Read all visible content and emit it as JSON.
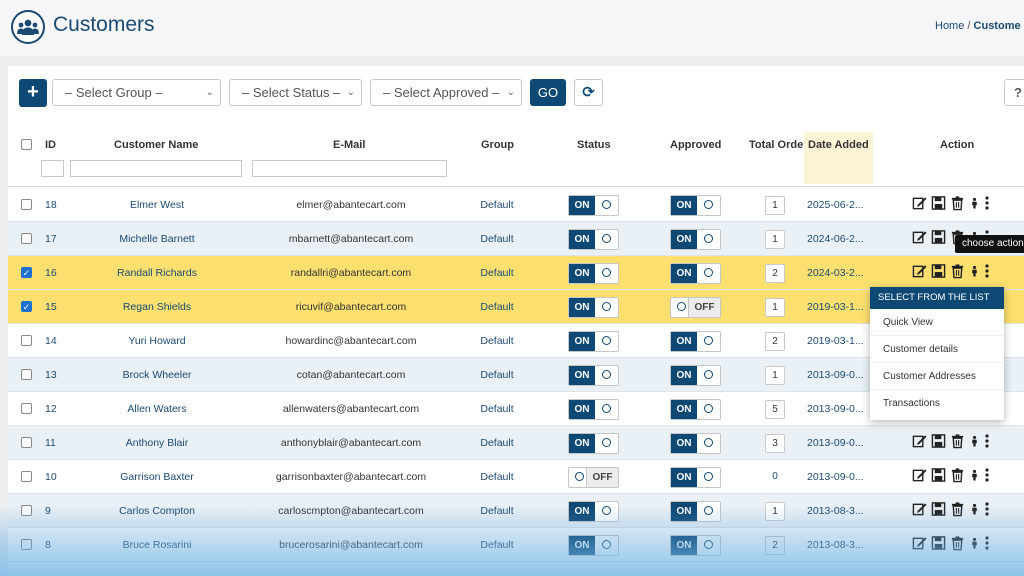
{
  "header": {
    "title": "Customers",
    "breadcrumb_home": "Home",
    "breadcrumb_sep": "/",
    "breadcrumb_current": "Custome"
  },
  "toolbar": {
    "add_label": "+",
    "group_select": "– Select Group –",
    "status_select": "– Select Status –",
    "approved_select": "– Select Approved –",
    "go_label": "GO",
    "refresh_icon": "refresh-icon",
    "help_label": "?"
  },
  "table": {
    "headers": {
      "id": "ID",
      "name": "Customer Name",
      "email": "E-Mail",
      "group": "Group",
      "status": "Status",
      "approved": "Approved",
      "total_orders": "Total Orde",
      "date_added": "Date Added",
      "action": "Action"
    },
    "on_label": "ON",
    "off_label": "OFF",
    "rows": [
      {
        "id": "18",
        "name": "Elmer West",
        "email": "elmer@abantecart.com",
        "group": "Default",
        "status": "ON",
        "approved": "ON",
        "orders": "1",
        "date": "2025-06-2...",
        "checked": false
      },
      {
        "id": "17",
        "name": "Michelle Barnett",
        "email": "mbarnett@abantecart.com",
        "group": "Default",
        "status": "ON",
        "approved": "ON",
        "orders": "1",
        "date": "2024-06-2...",
        "checked": false
      },
      {
        "id": "16",
        "name": "Randall Richards",
        "email": "randallri@abantecart.com",
        "group": "Default",
        "status": "ON",
        "approved": "ON",
        "orders": "2",
        "date": "2024-03-2...",
        "checked": true
      },
      {
        "id": "15",
        "name": "Regan Shields",
        "email": "ricuvif@abantecart.com",
        "group": "Default",
        "status": "ON",
        "approved": "OFF",
        "orders": "1",
        "date": "2019-03-1...",
        "checked": true
      },
      {
        "id": "14",
        "name": "Yuri Howard",
        "email": "howardinc@abantecart.com",
        "group": "Default",
        "status": "ON",
        "approved": "ON",
        "orders": "2",
        "date": "2019-03-1...",
        "checked": false
      },
      {
        "id": "13",
        "name": "Brock Wheeler",
        "email": "cotan@abantecart.com",
        "group": "Default",
        "status": "ON",
        "approved": "ON",
        "orders": "1",
        "date": "2013-09-0...",
        "checked": false
      },
      {
        "id": "12",
        "name": "Allen Waters",
        "email": "allenwaters@abantecart.com",
        "group": "Default",
        "status": "ON",
        "approved": "ON",
        "orders": "5",
        "date": "2013-09-0...",
        "checked": false
      },
      {
        "id": "11",
        "name": "Anthony Blair",
        "email": "anthonyblair@abantecart.com",
        "group": "Default",
        "status": "ON",
        "approved": "ON",
        "orders": "3",
        "date": "2013-09-0...",
        "checked": false
      },
      {
        "id": "10",
        "name": "Garrison Baxter",
        "email": "garrisonbaxter@abantecart.com",
        "group": "Default",
        "status": "OFF",
        "approved": "ON",
        "orders": "0",
        "date": "2013-09-0...",
        "checked": false
      },
      {
        "id": "9",
        "name": "Carlos Compton",
        "email": "carloscmpton@abantecart.com",
        "group": "Default",
        "status": "ON",
        "approved": "ON",
        "orders": "1",
        "date": "2013-08-3...",
        "checked": false
      },
      {
        "id": "8",
        "name": "Bruce Rosarini",
        "email": "brucerosarini@abantecart.com",
        "group": "Default",
        "status": "ON",
        "approved": "ON",
        "orders": "2",
        "date": "2013-08-3...",
        "checked": false
      }
    ]
  },
  "tooltip": "choose action",
  "action_menu": {
    "heading": "SELECT FROM THE LIST",
    "items": [
      "Quick View",
      "Customer details",
      "Customer Addresses",
      "Transactions"
    ]
  },
  "colors": {
    "brand": "#0e4874",
    "selected_row": "#fbe070",
    "alt_row": "#e9f0f6"
  }
}
